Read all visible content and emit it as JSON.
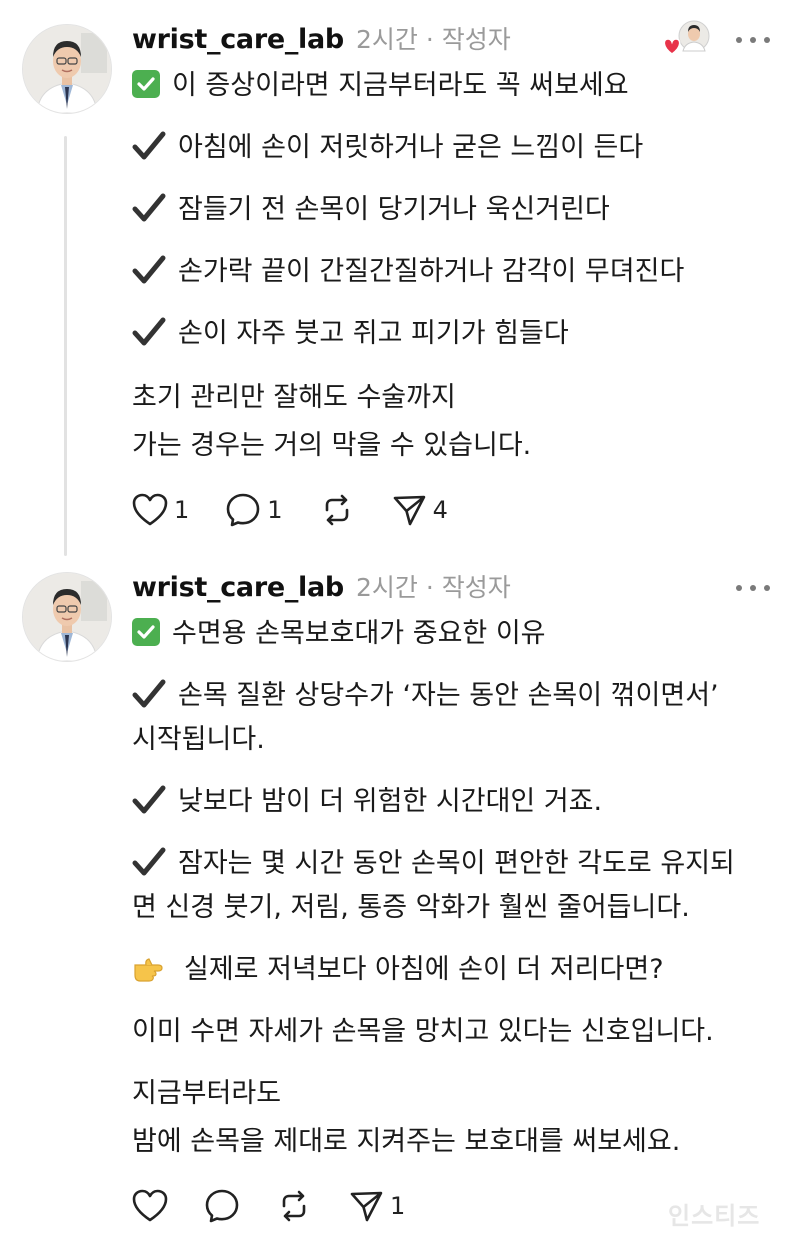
{
  "posts": [
    {
      "username": "wrist_care_lab",
      "time": "2시간",
      "role": "· 작성자",
      "headline": "이 증상이라면 지금부터라도 꼭 써보세요",
      "bullets": [
        "아침에 손이 저릿하거나 굳은 느낌이 든다",
        "잠들기 전 손목이 당기거나 욱신거린다",
        "손가락 끝이 간질간질하거나 감각이 무뎌진다",
        "손이 자주 붓고 쥐고 피기가 힘들다"
      ],
      "closing": [
        "초기 관리만 잘해도 수술까지",
        "가는 경우는 거의 막을 수 있습니다."
      ],
      "counts": {
        "likes": "1",
        "replies": "1",
        "reposts": "",
        "shares": "4"
      }
    },
    {
      "username": "wrist_care_lab",
      "time": "2시간",
      "role": "· 작성자",
      "headline": "수면용 손목보호대가 중요한 이유",
      "bullet1": [
        "손목 질환 상당수가 ‘자는 동안 손목이 꺾이면서’",
        "시작됩니다."
      ],
      "bullet2": "낮보다 밤이 더 위험한 시간대인 거죠.",
      "bullet3": [
        "잠자는 몇 시간 동안 손목이 편안한 각도로 유지되",
        "면 신경 붓기, 저림, 통증 악화가 훨씬 줄어듭니다."
      ],
      "pointer": "실제로 저녁보다 아침에 손이 더 저리다면?",
      "signal": "이미 수면 자세가 손목을 망치고 있다는 신호입니다.",
      "cta": [
        "지금부터라도",
        "밤에 손목을 제대로 지켜주는 보호대를 써보세요."
      ],
      "counts": {
        "likes": "",
        "replies": "",
        "reposts": "",
        "shares": "1"
      }
    }
  ],
  "watermark": "인스티즈",
  "colors": {
    "check_green": "#4caf50",
    "heart_red": "#e8334a",
    "muted": "#9a9a9a"
  }
}
